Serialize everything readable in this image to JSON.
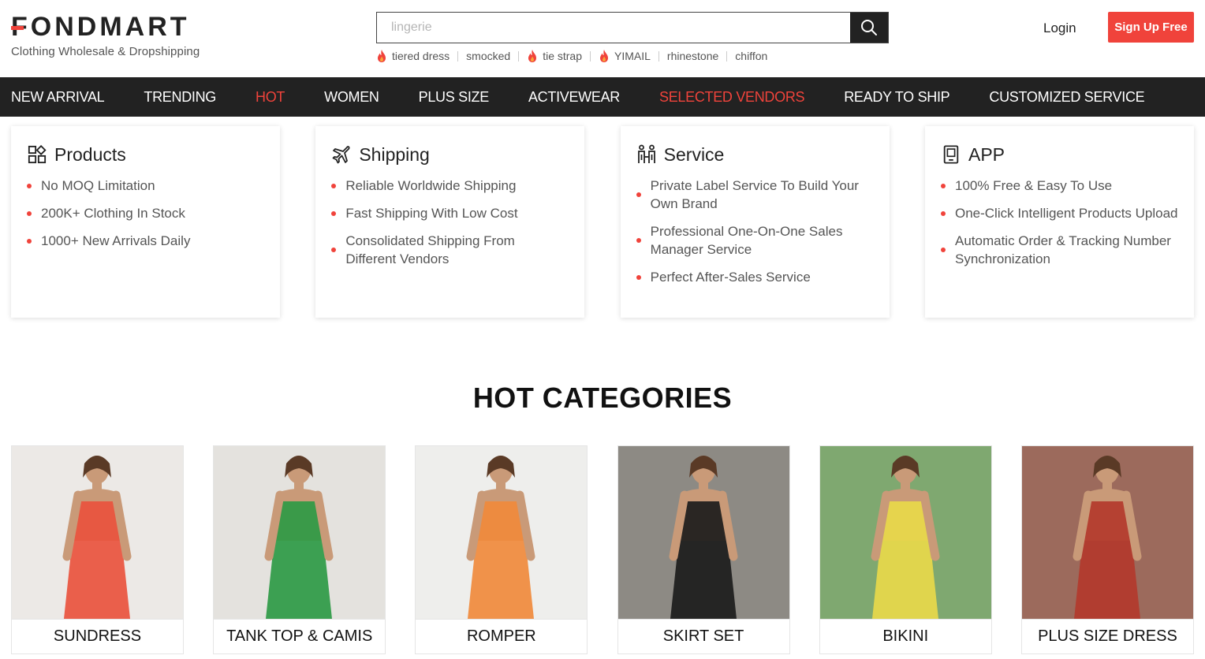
{
  "brand": {
    "name": "FONDMART",
    "tagline": "Clothing Wholesale & Dropshipping",
    "accent": "#f0433b"
  },
  "search": {
    "placeholder": "lingerie",
    "hot_words": [
      {
        "label": "tiered dress",
        "hot": true
      },
      {
        "label": "smocked",
        "hot": false
      },
      {
        "label": "tie strap",
        "hot": true
      },
      {
        "label": "YIMAIL",
        "hot": true
      },
      {
        "label": "rhinestone",
        "hot": false
      },
      {
        "label": "chiffon",
        "hot": false
      }
    ]
  },
  "account": {
    "login": "Login",
    "signup": "Sign Up Free"
  },
  "nav": [
    {
      "label": "NEW ARRIVAL",
      "highlight": false
    },
    {
      "label": "TRENDING",
      "highlight": false
    },
    {
      "label": "HOT",
      "highlight": true
    },
    {
      "label": "WOMEN",
      "highlight": false
    },
    {
      "label": "PLUS SIZE",
      "highlight": false
    },
    {
      "label": "ACTIVEWEAR",
      "highlight": false
    },
    {
      "label": "SELECTED VENDORS",
      "highlight": true
    },
    {
      "label": "READY TO SHIP",
      "highlight": false
    },
    {
      "label": "CUSTOMIZED SERVICE",
      "highlight": false
    }
  ],
  "features": [
    {
      "icon": "grid-icon",
      "title": "Products",
      "items": [
        "No MOQ Limitation",
        "200K+ Clothing In Stock",
        "1000+ New Arrivals Daily"
      ]
    },
    {
      "icon": "plane-icon",
      "title": "Shipping",
      "items": [
        "Reliable Worldwide Shipping",
        "Fast Shipping With Low Cost",
        "Consolidated Shipping From Different Vendors"
      ]
    },
    {
      "icon": "people-icon",
      "title": "Service",
      "items": [
        "Private Label Service To Build Your Own Brand",
        "Professional One-On-One Sales Manager Service",
        "Perfect After-Sales Service"
      ]
    },
    {
      "icon": "phone-icon",
      "title": "APP",
      "items": [
        "100% Free & Easy To Use",
        "One-Click Intelligent Products Upload",
        "Automatic Order & Tracking Number Synchronization"
      ]
    }
  ],
  "hot_categories": {
    "title": "HOT CATEGORIES",
    "items": [
      {
        "label": "SUNDRESS",
        "bg": "#ece9e6",
        "garment": "#e9523e"
      },
      {
        "label": "TANK TOP & CAMIS",
        "bg": "#e4e2de",
        "garment": "#2e9a45"
      },
      {
        "label": "ROMPER",
        "bg": "#eeeeec",
        "garment": "#f08a3c"
      },
      {
        "label": "SKIRT SET",
        "bg": "#8d8a84",
        "garment": "#1c1c1c"
      },
      {
        "label": "BIKINI",
        "bg": "#7fa870",
        "garment": "#e8d94a"
      },
      {
        "label": "PLUS SIZE DRESS",
        "bg": "#9c6a5c",
        "garment": "#b3392c"
      }
    ]
  }
}
